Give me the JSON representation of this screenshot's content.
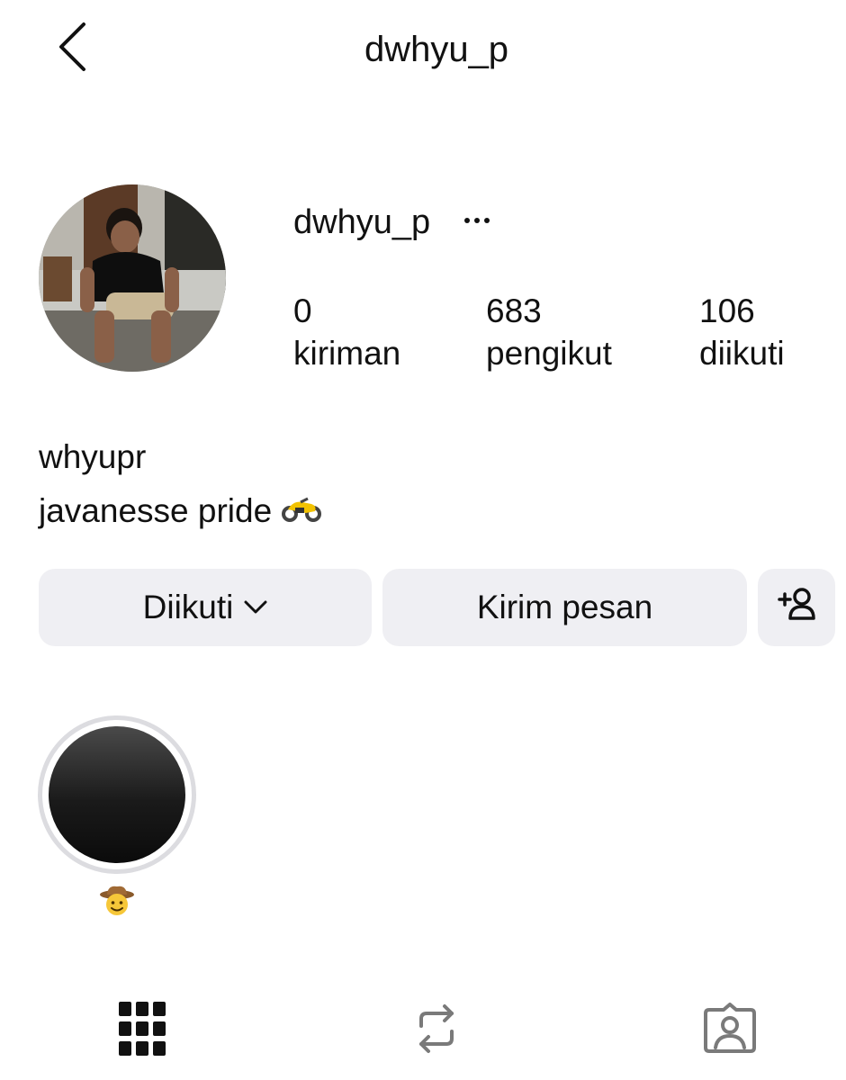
{
  "header": {
    "title": "dwhyu_p",
    "back_icon": "chevron-left-icon"
  },
  "profile": {
    "username": "dwhyu_p",
    "more_icon": "more-horizontal-icon",
    "stats": [
      {
        "count": "0",
        "label": "kiriman"
      },
      {
        "count": "683",
        "label": "pengikut"
      },
      {
        "count": "106",
        "label": "diikuti"
      }
    ],
    "bio": {
      "name": "whyupr",
      "text": "javanesse pride",
      "emoji_icon": "motorcycle-emoji-icon"
    }
  },
  "actions": {
    "following_label": "Diikuti",
    "message_label": "Kirim pesan",
    "add_user_icon": "add-user-icon"
  },
  "highlights": [
    {
      "label_icon": "cowboy-face-emoji-icon"
    }
  ],
  "tabs": [
    {
      "icon": "grid-icon",
      "active": true
    },
    {
      "icon": "repost-icon",
      "active": false
    },
    {
      "icon": "tagged-icon",
      "active": false
    }
  ],
  "colors": {
    "button_bg": "#efeff3",
    "text": "#111111",
    "highlight_ring": "#dcdce0",
    "tab_inactive": "#7a7a7a",
    "tab_active": "#111111"
  }
}
